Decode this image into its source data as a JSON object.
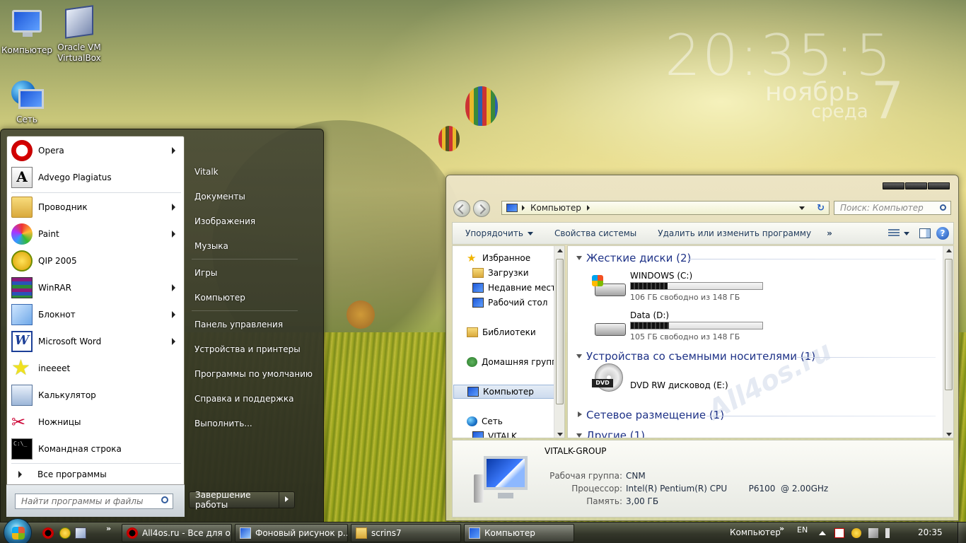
{
  "desktop": {
    "icons": [
      {
        "label": "Компьютер",
        "icon": "computer-icon"
      },
      {
        "label": "Oracle VM VirtualBox",
        "icon": "virtualbox-icon"
      },
      {
        "label": "Сеть",
        "icon": "network-icon"
      }
    ],
    "clock": {
      "time": "20:35:5",
      "month": "ноябрь",
      "weekday": "среда",
      "date": "7"
    }
  },
  "start_menu": {
    "pinned": [
      {
        "label": "Opera",
        "icon": "opera-icon",
        "has_submenu": true
      },
      {
        "label": "Advego Plagiatus",
        "icon": "advego-icon",
        "has_submenu": false
      }
    ],
    "recent": [
      {
        "label": "Проводник",
        "icon": "explorer-folder-icon",
        "has_submenu": true
      },
      {
        "label": "Paint",
        "icon": "paint-icon",
        "has_submenu": true
      },
      {
        "label": "QIP 2005",
        "icon": "qip-icon",
        "has_submenu": false
      },
      {
        "label": "WinRAR",
        "icon": "winrar-icon",
        "has_submenu": true
      },
      {
        "label": "Блокнот",
        "icon": "notepad-icon",
        "has_submenu": true
      },
      {
        "label": "Microsoft Word",
        "icon": "word-icon",
        "has_submenu": true
      },
      {
        "label": "ineeeet",
        "icon": "star-icon",
        "has_submenu": false
      },
      {
        "label": "Калькулятор",
        "icon": "calculator-icon",
        "has_submenu": false
      },
      {
        "label": "Ножницы",
        "icon": "scissors-icon",
        "has_submenu": false
      },
      {
        "label": "Командная строка",
        "icon": "cmd-icon",
        "has_submenu": false
      }
    ],
    "all_programs": "Все программы",
    "search_placeholder": "Найти программы и файлы",
    "right_items": [
      "Vitalk",
      "Документы",
      "Изображения",
      "Музыка",
      "Игры",
      "Компьютер",
      "Панель управления",
      "Устройства и принтеры",
      "Программы по умолчанию",
      "Справка и поддержка",
      "Выполнить..."
    ],
    "shutdown_label": "Завершение работы"
  },
  "explorer": {
    "address": "Компьютер",
    "search_placeholder": "Поиск: Компьютер",
    "toolbar": {
      "organize": "Упорядочить",
      "system_properties": "Свойства системы",
      "uninstall": "Удалить или изменить программу",
      "more": "»"
    },
    "nav": {
      "favorites": "Избранное",
      "downloads": "Загрузки",
      "recent_places": "Недавние места",
      "desktop": "Рабочий стол",
      "libraries": "Библиотеки",
      "homegroup": "Домашняя группа",
      "computer": "Компьютер",
      "network": "Сеть",
      "network_pc": "VITALK"
    },
    "groups": {
      "hard_drives": "Жесткие диски (2)",
      "removable": "Устройства со съемными носителями (1)",
      "network_locations": "Сетевое размещение (1)",
      "other": "Другие (1)"
    },
    "drives": [
      {
        "name": "WINDOWS (C:)",
        "free_text": "106 ГБ свободно из 148 ГБ",
        "used_fraction": 0.28
      },
      {
        "name": "Data (D:)",
        "free_text": "105 ГБ свободно из 148 ГБ",
        "used_fraction": 0.29
      }
    ],
    "dvd": {
      "name": "DVD RW дисковод (E:)",
      "badge": "DVD"
    },
    "watermark": "All4os.ru",
    "details": {
      "title": "VITALK-GROUP",
      "workgroup_label": "Рабочая группа:",
      "workgroup_value": "CNM",
      "cpu_label": "Процессор:",
      "cpu_value": "Intel(R) Pentium(R) CPU        P6100  @ 2.00GHz",
      "memory_label": "Память:",
      "memory_value": "3,00 ГБ"
    }
  },
  "taskbar": {
    "quick_more": "»",
    "tasks": [
      {
        "label": "All4os.ru - Все для о...",
        "icon": "opera-icon"
      },
      {
        "label": "Фоновый рисунок р...",
        "icon": "control-panel-icon"
      },
      {
        "label": "scrins7",
        "icon": "folder-icon"
      },
      {
        "label": "Компьютер",
        "icon": "computer-icon"
      }
    ],
    "toolbar_label": "Компьютер",
    "toolbar_more": "»",
    "language": "EN",
    "time": "20:35"
  }
}
